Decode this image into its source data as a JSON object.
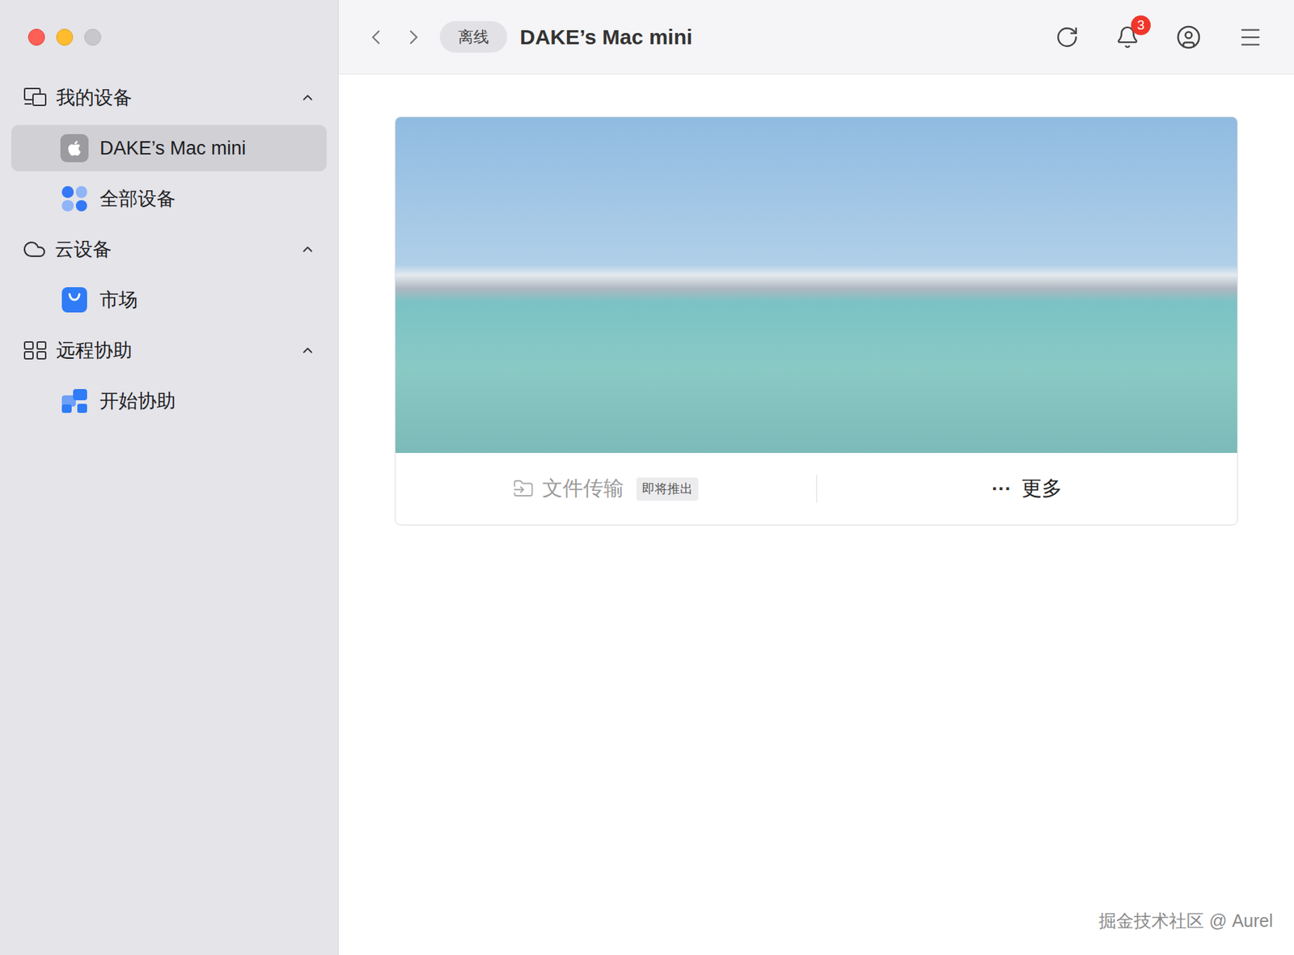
{
  "window": {
    "title": "DAKE’s Mac mini",
    "status": "离线"
  },
  "toolbar": {
    "notifications": "3"
  },
  "sidebar": {
    "sections": [
      {
        "label": "我的设备",
        "kind": "devices",
        "expanded": true,
        "items": [
          {
            "label": "DAKE’s Mac mini",
            "kind": "apple",
            "selected": true
          },
          {
            "label": "全部设备",
            "kind": "grid",
            "selected": false
          }
        ]
      },
      {
        "label": "云设备",
        "kind": "cloud",
        "expanded": true,
        "items": [
          {
            "label": "市场",
            "kind": "store",
            "selected": false
          }
        ]
      },
      {
        "label": "远程协助",
        "kind": "remote",
        "expanded": true,
        "items": [
          {
            "label": "开始协助",
            "kind": "collab",
            "selected": false
          }
        ]
      }
    ]
  },
  "device_card": {
    "actions": [
      {
        "kind": "transfer",
        "label": "文件传输",
        "badge": "即将推出",
        "disabled": true
      },
      {
        "kind": "more",
        "glyph": "···",
        "label": "更多",
        "disabled": false
      }
    ]
  },
  "watermark": "掘金技术社区 @ Aurel"
}
